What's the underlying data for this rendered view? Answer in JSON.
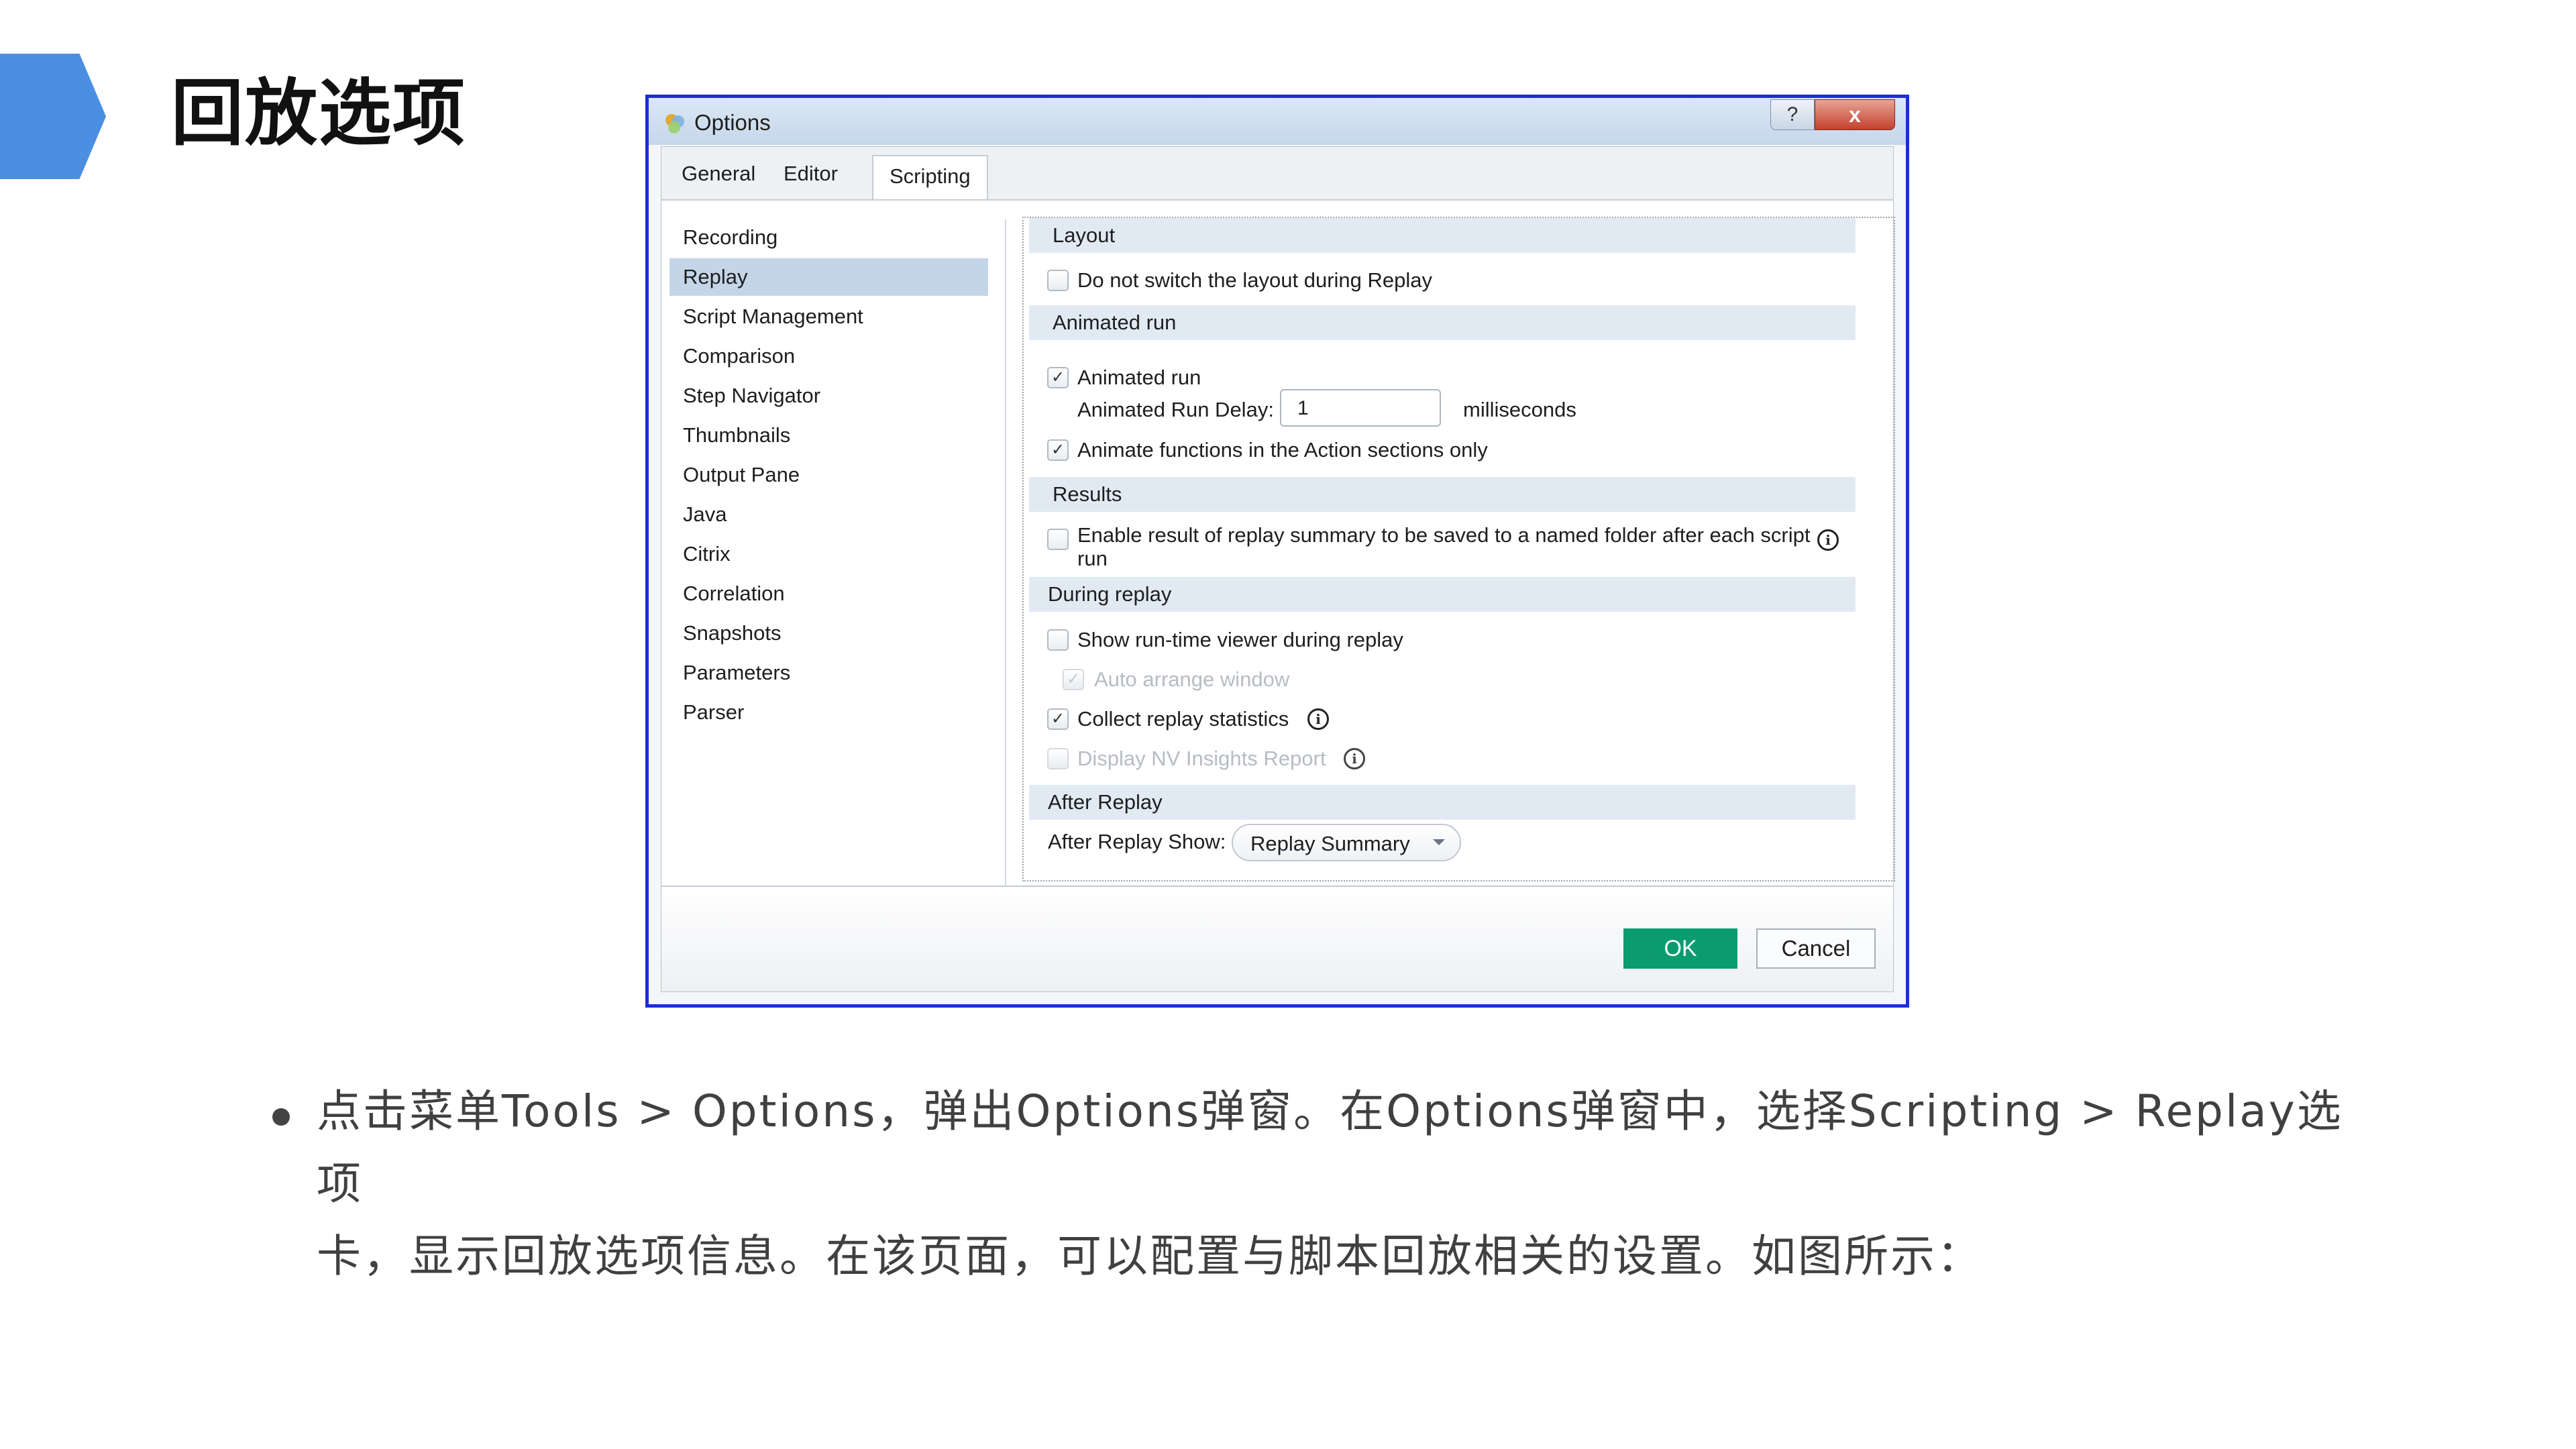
{
  "slide": {
    "title": "回放选项",
    "caption_line1": "点击菜单Tools > Options，弹出Options弹窗。在Options弹窗中，选择Scripting > Replay选项",
    "caption_line2": "卡，显示回放选项信息。在该页面，可以配置与脚本回放相关的设置。如图所示："
  },
  "dialog": {
    "title": "Options",
    "help_label": "?",
    "close_label": "x",
    "tabs": [
      "General",
      "Editor",
      "Scripting"
    ],
    "active_tab": "Scripting",
    "nav_items": [
      "Recording",
      "Replay",
      "Script Management",
      "Comparison",
      "Step Navigator",
      "Thumbnails",
      "Output Pane",
      "Java",
      "Citrix",
      "Correlation",
      "Snapshots",
      "Parameters",
      "Parser"
    ],
    "selected_nav": "Replay",
    "sections": {
      "layout": {
        "header": "Layout",
        "no_switch_label": "Do not switch the layout during Replay",
        "no_switch_checked": false
      },
      "animated_run": {
        "header": "Animated run",
        "animated_run_label": "Animated run",
        "animated_run_checked": true,
        "delay_label": "Animated Run Delay:",
        "delay_value": "1",
        "delay_unit": "milliseconds",
        "animate_functions_label": "Animate functions in the Action sections only",
        "animate_functions_checked": true
      },
      "results": {
        "header": "Results",
        "enable_result_label_1": "Enable result of replay summary to be saved to a named folder after each script",
        "enable_result_label_2": "run",
        "enable_result_checked": false
      },
      "during_replay": {
        "header": "During replay",
        "show_viewer_label": "Show run-time viewer during replay",
        "show_viewer_checked": false,
        "auto_arrange_label": "Auto arrange window",
        "auto_arrange_checked": true,
        "auto_arrange_disabled": true,
        "collect_stats_label": "Collect replay statistics",
        "collect_stats_checked": true,
        "display_nv_label": "Display NV Insights Report",
        "display_nv_checked": false,
        "display_nv_disabled": true
      },
      "after_replay": {
        "header": "After Replay",
        "show_label": "After Replay Show:",
        "show_value": "Replay Summary"
      }
    },
    "ok_label": "OK",
    "cancel_label": "Cancel"
  },
  "icons": {
    "check": "✓",
    "info": "i",
    "accent_color": "#4a8fe2",
    "ok_color": "#0a9c6f"
  }
}
